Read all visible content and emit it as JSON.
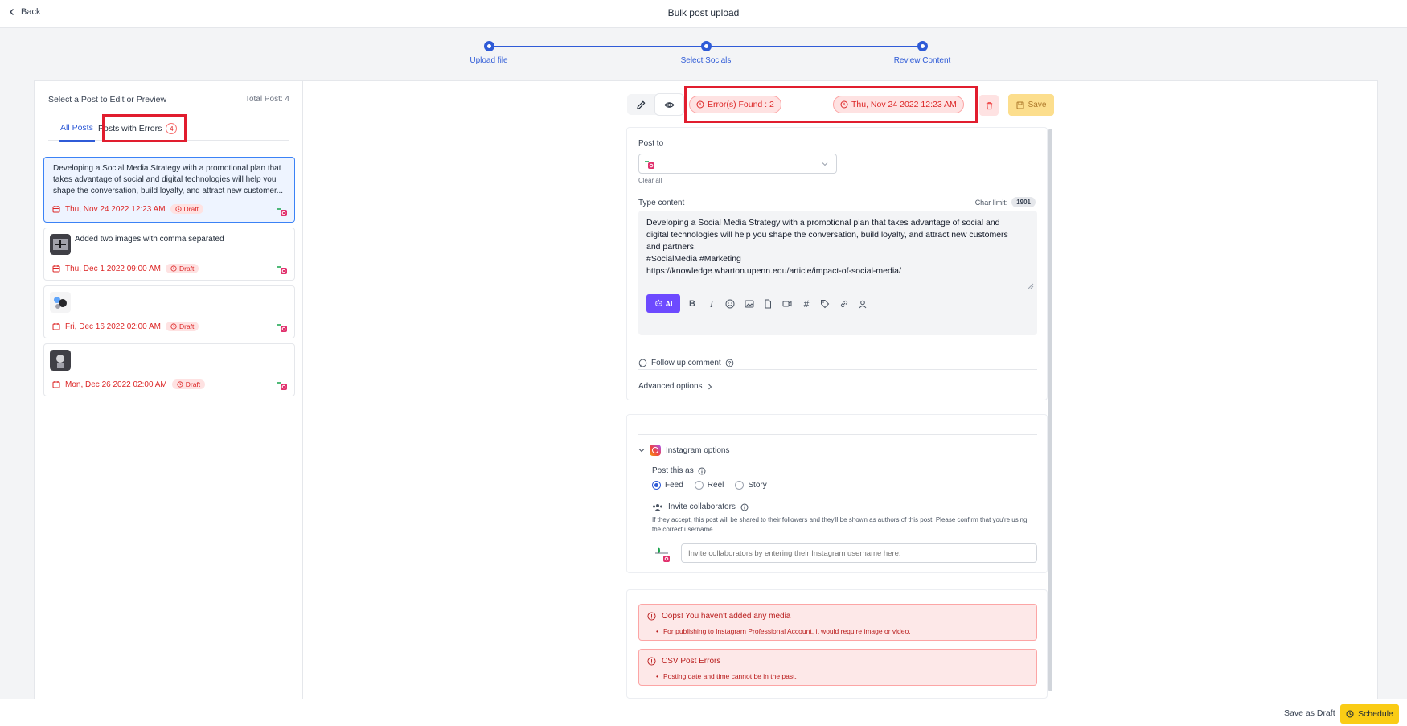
{
  "header": {
    "back_label": "Back",
    "title": "Bulk post upload"
  },
  "stepper": {
    "steps": [
      "Upload file",
      "Select Socials",
      "Review Content"
    ]
  },
  "left": {
    "heading": "Select a Post to Edit or Preview",
    "total": "Total Post: 4",
    "tabs": {
      "all": "All Posts",
      "errors": "Posts with Errors",
      "errors_count": "4"
    },
    "posts": [
      {
        "text": "Developing a Social Media Strategy with a promotional plan that takes advantage of social and digital technologies will help you shape the conversation, build loyalty, and attract new customer...",
        "date": "Thu, Nov 24 2022 12:23 AM",
        "status": "Draft"
      },
      {
        "text": "Added two images with comma separated",
        "date": "Thu, Dec 1 2022 09:00 AM",
        "status": "Draft"
      },
      {
        "text": "",
        "date": "Fri, Dec 16 2022 02:00 AM",
        "status": "Draft"
      },
      {
        "text": "",
        "date": "Mon, Dec 26 2022 02:00 AM",
        "status": "Draft"
      }
    ]
  },
  "toolbar": {
    "errors_found": "Error(s) Found : 2",
    "schedule_date": "Thu, Nov 24 2022 12:23 AM",
    "save_label": "Save"
  },
  "editor": {
    "post_to_label": "Post to",
    "clear_all": "Clear all",
    "type_content_label": "Type content",
    "char_limit_label": "Char limit:",
    "char_limit_value": "1901",
    "content": "Developing a Social Media Strategy with a promotional plan that takes advantage of social and\ndigital technologies will help you shape the conversation, build loyalty, and attract new customers\nand partners.\n#SocialMedia #Marketing\nhttps://knowledge.wharton.upenn.edu/article/impact-of-social-media/",
    "ai_label": "AI",
    "follow_up": "Follow up comment",
    "advanced": "Advanced options"
  },
  "instagram": {
    "title": "Instagram options",
    "post_as_label": "Post this as",
    "options": [
      "Feed",
      "Reel",
      "Story"
    ],
    "selected": "Feed",
    "collab_label": "Invite collaborators",
    "collab_note": "If they accept, this post will be shared to their followers and they'll be shown as authors of this post. Please confirm that you're using the correct username.",
    "collab_placeholder": "Invite collaborators by entering their Instagram username here."
  },
  "errors": [
    {
      "title": "Oops! You haven't added any media",
      "item": "For publishing to Instagram Professional Account, it would require image or video."
    },
    {
      "title": "CSV Post Errors",
      "item": "Posting date and time cannot be in the past."
    }
  ],
  "footer": {
    "save_draft": "Save as Draft",
    "schedule": "Schedule"
  },
  "colors": {
    "primary": "#2f5bd7",
    "error": "#dc2626",
    "highlight": "#e11d2e",
    "ai": "#6d4aff",
    "schedule": "#facc15"
  }
}
